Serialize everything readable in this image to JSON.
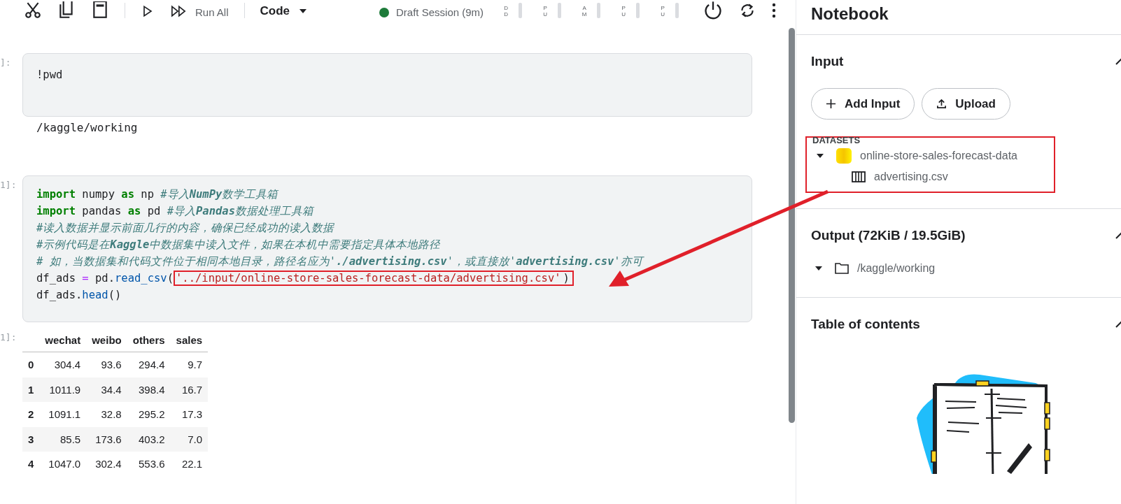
{
  "toolbar": {
    "run_all": "Run All",
    "cell_type": "Code",
    "session": "Draft Session (9m)",
    "meters": [
      {
        "label": "DD"
      },
      {
        "label": "PU"
      },
      {
        "label": "AM"
      },
      {
        "label": "PU"
      },
      {
        "label": "PU"
      }
    ]
  },
  "cells": [
    {
      "prompt": "]:",
      "lines": [
        [
          {
            "kind": "plain",
            "s": "!pwd"
          }
        ]
      ],
      "output": {
        "kind": "text",
        "text": "/kaggle/working"
      }
    },
    {
      "prompt": "1]:",
      "lines": [
        [
          {
            "kind": "keyword",
            "s": "import"
          },
          {
            "kind": "plain",
            "s": " numpy "
          },
          {
            "kind": "keyword",
            "s": "as"
          },
          {
            "kind": "plain",
            "s": " np "
          },
          {
            "kind": "comment",
            "s": "#导入**NumPy**数学工具箱"
          }
        ],
        [
          {
            "kind": "keyword",
            "s": "import"
          },
          {
            "kind": "plain",
            "s": " pandas "
          },
          {
            "kind": "keyword",
            "s": "as"
          },
          {
            "kind": "plain",
            "s": " pd "
          },
          {
            "kind": "comment",
            "s": "#导入**Pandas**数据处理工具箱"
          }
        ],
        [
          {
            "kind": "comment",
            "s": "#读入数据并显示前面几行的内容，确保已经成功的读入数据"
          }
        ],
        [
          {
            "kind": "comment",
            "s": "#示例代码是在**Kaggle**中数据集中读入文件，如果在本机中需要指定具体本地路径"
          }
        ],
        [
          {
            "kind": "comment",
            "s": "# 如，当数据集和代码文件位于相同本地目录，路径名应为'**./advertising.csv**'，或直接放'**advertising.csv**'亦可"
          }
        ],
        [
          {
            "kind": "plain",
            "s": "df_ads "
          },
          {
            "kind": "operator",
            "s": "="
          },
          {
            "kind": "plain",
            "s": " pd."
          },
          {
            "kind": "function",
            "s": "read_csv"
          },
          {
            "kind": "plain",
            "s": "("
          },
          {
            "kind": "marked",
            "s": "'../input/online-store-sales-forecast-data/advertising.csv'"
          },
          {
            "kind": "plain",
            "s": ")"
          }
        ],
        [
          {
            "kind": "plain",
            "s": "df_ads."
          },
          {
            "kind": "function",
            "s": "head"
          },
          {
            "kind": "plain",
            "s": "()"
          }
        ]
      ],
      "output": {
        "kind": "table",
        "prompt": "1]:",
        "columns": [
          "wechat",
          "weibo",
          "others",
          "sales"
        ],
        "rows": [
          {
            "index": "0",
            "cells": [
              "304.4",
              "93.6",
              "294.4",
              "9.7"
            ]
          },
          {
            "index": "1",
            "cells": [
              "1011.9",
              "34.4",
              "398.4",
              "16.7"
            ]
          },
          {
            "index": "2",
            "cells": [
              "1091.1",
              "32.8",
              "295.2",
              "17.3"
            ]
          },
          {
            "index": "3",
            "cells": [
              "85.5",
              "173.6",
              "403.2",
              "7.0"
            ]
          },
          {
            "index": "4",
            "cells": [
              "1047.0",
              "302.4",
              "553.6",
              "22.1"
            ]
          }
        ]
      }
    }
  ],
  "panel": {
    "title": "Notebook",
    "sections": [
      {
        "kind": "input",
        "title": "Input",
        "expanded": true,
        "buttons": [
          {
            "kind": "add",
            "label": "Add Input"
          },
          {
            "kind": "upload",
            "label": "Upload"
          }
        ],
        "group_label": "DATASETS",
        "tree": [
          {
            "kind": "dataset",
            "label": "online-store-sales-forecast-data",
            "expanded": true,
            "children": [
              {
                "kind": "table",
                "label": "advertising.csv"
              }
            ]
          }
        ]
      },
      {
        "kind": "output",
        "title": "Output (72KiB / 19.5GiB)",
        "expanded": true,
        "tree": [
          {
            "kind": "folder",
            "label": "/kaggle/working",
            "expanded": true
          }
        ]
      },
      {
        "kind": "toc",
        "title": "Table of contents",
        "expanded": true
      }
    ]
  }
}
